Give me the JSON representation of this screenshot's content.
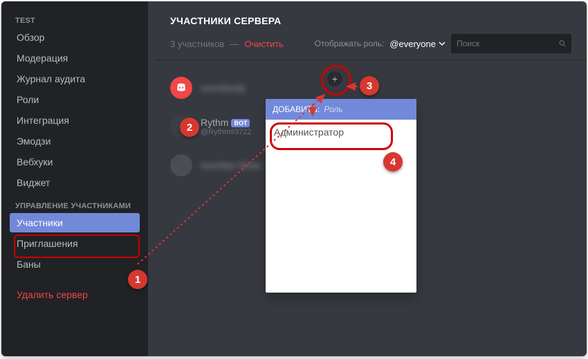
{
  "sidebar": {
    "cat1": "TEST",
    "items1": [
      "Обзор",
      "Модерация",
      "Журнал аудита",
      "Роли",
      "Интеграция",
      "Эмодзи",
      "Вебхуки",
      "Виджет"
    ],
    "cat2": "УПРАВЛЕНИЕ УЧАСТНИКАМИ",
    "items2": [
      "Участники",
      "Приглашения",
      "Баны"
    ],
    "delete": "Удалить сервер"
  },
  "main": {
    "title": "УЧАСТНИКИ СЕРВЕРА",
    "count": "3 участников",
    "dash": "—",
    "clear": "Очистить",
    "display_role_label": "Отображать роль:",
    "role_selected": "@everyone",
    "search_placeholder": "Поиск"
  },
  "members": [
    {
      "name": "somebody",
      "tag": "",
      "type": "discord",
      "blur": true
    },
    {
      "name": "Rythm",
      "tag": "@Rythm#3722",
      "type": "bot",
      "blur": false,
      "bot_label": "BOT"
    },
    {
      "name": "member three",
      "tag": "",
      "type": "user",
      "blur": true
    }
  ],
  "popup": {
    "add_label": "ДОБАВИТЬ:",
    "placeholder": "Роль",
    "item": "Администратор"
  },
  "annotations": {
    "1": "1",
    "2": "2",
    "3": "3",
    "4": "4"
  }
}
